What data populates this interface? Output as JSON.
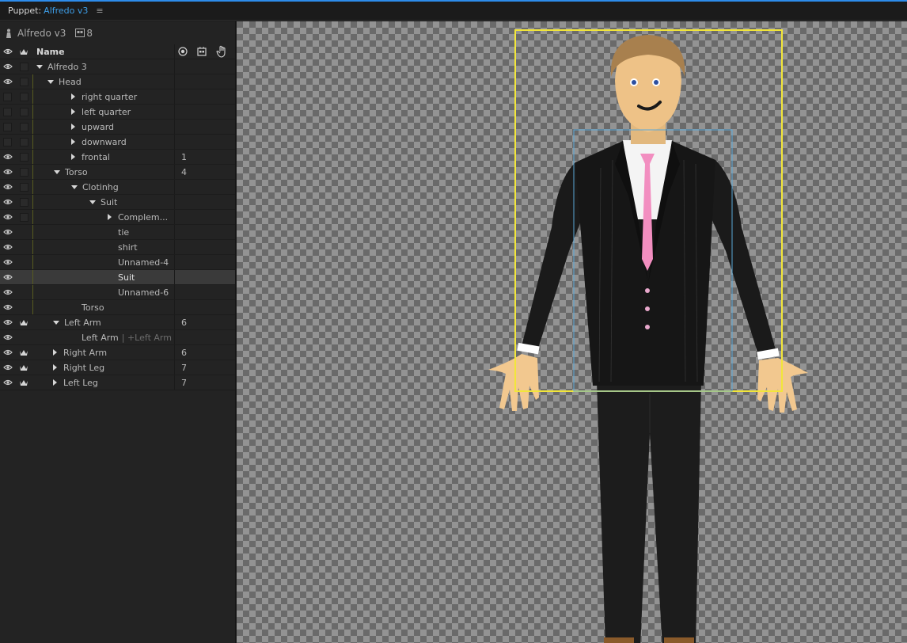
{
  "tab": {
    "prefix": "Puppet:",
    "name": "Alfredo v3",
    "menu_glyph": "≡"
  },
  "puppet": {
    "name": "Alfredo v3",
    "tag_count": "8"
  },
  "header": {
    "name_label": "Name"
  },
  "rows": [
    {
      "label": "Alfredo 3",
      "num": "",
      "extra": ""
    },
    {
      "label": "Head",
      "num": "",
      "extra": ""
    },
    {
      "label": "right quarter",
      "num": "",
      "extra": ""
    },
    {
      "label": "left quarter",
      "num": "",
      "extra": ""
    },
    {
      "label": "upward",
      "num": "",
      "extra": ""
    },
    {
      "label": "downward",
      "num": "",
      "extra": ""
    },
    {
      "label": "frontal",
      "num": "1",
      "extra": ""
    },
    {
      "label": "Torso",
      "num": "4",
      "extra": ""
    },
    {
      "label": "Clotinhg",
      "num": "",
      "extra": ""
    },
    {
      "label": "Suit",
      "num": "",
      "extra": ""
    },
    {
      "label": "Complem...",
      "num": "",
      "extra": ""
    },
    {
      "label": "tie",
      "num": "",
      "extra": ""
    },
    {
      "label": "shirt",
      "num": "",
      "extra": ""
    },
    {
      "label": "Unnamed-4",
      "num": "",
      "extra": ""
    },
    {
      "label": "Suit",
      "num": "",
      "extra": ""
    },
    {
      "label": "Unnamed-6",
      "num": "",
      "extra": ""
    },
    {
      "label": "Torso",
      "num": "",
      "extra": ""
    },
    {
      "label": "Left Arm",
      "num": "6",
      "extra": ""
    },
    {
      "label": "Left Arm",
      "num": "",
      "extra": "| +Left Arm"
    },
    {
      "label": "Right Arm",
      "num": "6",
      "extra": ""
    },
    {
      "label": "Right Leg",
      "num": "7",
      "extra": ""
    },
    {
      "label": "Left Leg",
      "num": "7",
      "extra": ""
    }
  ],
  "colors": {
    "accent": "#3d9ee8",
    "selection_box": "#f2e63a",
    "sub_box": "#5aa8d8",
    "tie": "#f28ec0"
  }
}
